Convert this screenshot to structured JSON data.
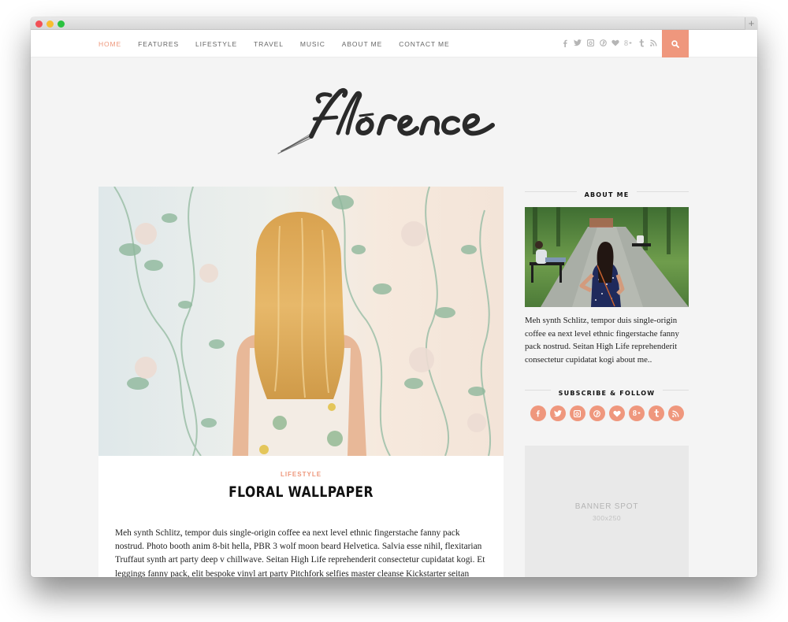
{
  "browser": {
    "new_tab_label": "+"
  },
  "nav": {
    "items": [
      {
        "label": "HOME",
        "active": true
      },
      {
        "label": "FEATURES",
        "active": false
      },
      {
        "label": "LIFESTYLE",
        "active": false
      },
      {
        "label": "TRAVEL",
        "active": false
      },
      {
        "label": "MUSIC",
        "active": false
      },
      {
        "label": "ABOUT ME",
        "active": false
      },
      {
        "label": "CONTACT ME",
        "active": false
      }
    ],
    "social_icons": [
      {
        "name": "facebook-icon",
        "glyph": "f"
      },
      {
        "name": "twitter-icon",
        "glyph": "🐦"
      },
      {
        "name": "instagram-icon",
        "glyph": "▣"
      },
      {
        "name": "pinterest-icon",
        "glyph": "℗"
      },
      {
        "name": "bloglovin-heart-icon",
        "glyph": "♥"
      },
      {
        "name": "google-plus-icon",
        "glyph": "g+"
      },
      {
        "name": "tumblr-icon",
        "glyph": "t"
      },
      {
        "name": "rss-icon",
        "glyph": "≫"
      }
    ],
    "search_icon": "search-icon"
  },
  "site": {
    "logo_text": "florence"
  },
  "post": {
    "category": "LIFESTYLE",
    "title": "FLORAL WALLPAPER",
    "excerpt": "Meh synth Schlitz, tempor duis single-origin coffee ea next level ethnic fingerstache fanny pack nostrud. Photo booth anim 8-bit hella, PBR 3 wolf moon beard Helvetica. Salvia esse nihil, flexitarian Truffaut synth art party deep v chillwave. Seitan High Life reprehenderit consectetur cupidatat kogi. Et leggings fanny pack, elit bespoke vinyl art party Pitchfork selfies master cleanse Kickstarter seitan retro.",
    "image_alt": "Woman with long blonde hair facing floral wallpaper"
  },
  "sidebar": {
    "about": {
      "title": "ABOUT ME",
      "image_alt": "Woman in polka dot dress standing on a park path",
      "text": "Meh synth Schlitz, tempor duis single-origin coffee ea next level ethnic fingerstache fanny pack nostrud. Seitan High Life reprehenderit consectetur cupidatat kogi about me.."
    },
    "subscribe": {
      "title": "SUBSCRIBE & FOLLOW",
      "icons": [
        {
          "name": "facebook-icon",
          "glyph": "f"
        },
        {
          "name": "twitter-icon",
          "glyph": "t"
        },
        {
          "name": "instagram-icon",
          "glyph": "◙"
        },
        {
          "name": "pinterest-icon",
          "glyph": "p"
        },
        {
          "name": "bloglovin-heart-icon",
          "glyph": "♥"
        },
        {
          "name": "google-plus-icon",
          "glyph": "g+"
        },
        {
          "name": "tumblr-icon",
          "glyph": "t"
        },
        {
          "name": "rss-icon",
          "glyph": ")"
        }
      ]
    },
    "banner": {
      "title": "BANNER SPOT",
      "size": "300x250"
    }
  },
  "colors": {
    "accent": "#ef977d",
    "background": "#f4f4f4",
    "text": "#222222"
  }
}
